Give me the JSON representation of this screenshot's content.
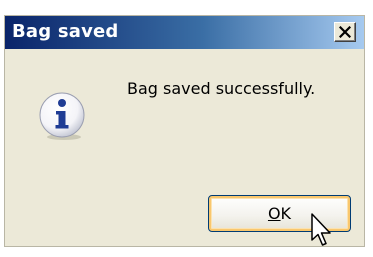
{
  "window": {
    "title": "Bag saved",
    "close_icon": "close-icon"
  },
  "dialog": {
    "icon": "info-icon",
    "message": "Bag saved successfully."
  },
  "buttons": {
    "ok_mnemonic": "O",
    "ok_rest": "K"
  },
  "colors": {
    "title_bar_start": "#0A246A",
    "title_bar_end": "#A6CAF0",
    "dialog_bg": "#ECE9D8",
    "icon_blue": "#1F3C94",
    "button_focus": "#F9C76E"
  }
}
